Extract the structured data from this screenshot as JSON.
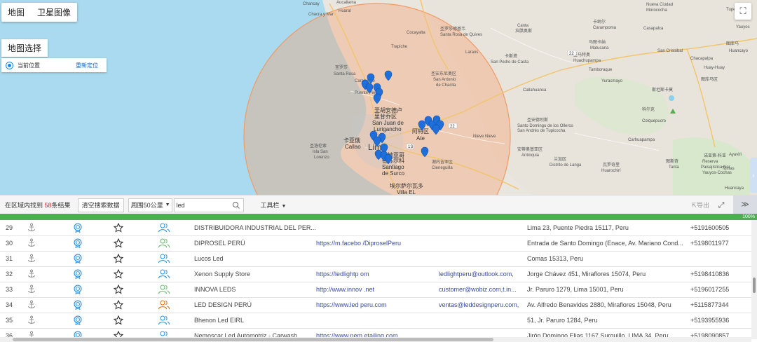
{
  "map": {
    "maptype_tabs": [
      "地图",
      "卫星图像"
    ],
    "map_select_label": "地图选择",
    "current_location_label": "当前位置",
    "relocate_label": "重新定位",
    "place_labels": [
      {
        "text": "Chancay"
      },
      {
        "text": "Chacra y Mar"
      },
      {
        "text": "Huaral"
      },
      {
        "text": "Aucallama"
      },
      {
        "text": "Cocayalta"
      },
      {
        "text": "Trapiche"
      },
      {
        "text": "圣罗莎"
      },
      {
        "text": "Santa Rosa"
      },
      {
        "text": "卡拉韦约"
      },
      {
        "text": "Carabayllo"
      },
      {
        "text": "Puente Piedra"
      },
      {
        "text": "圣胡安德卢"
      },
      {
        "text": "里甘乔区"
      },
      {
        "text": "San Juan de"
      },
      {
        "text": "Lurigancho"
      },
      {
        "text": "卡亚俄"
      },
      {
        "text": "Callao"
      },
      {
        "text": "Lima"
      },
      {
        "text": "阿特区"
      },
      {
        "text": "Ate"
      },
      {
        "text": "圣洛伦索"
      },
      {
        "text": "Isla San"
      },
      {
        "text": "Lorenzo"
      },
      {
        "text": "圣地亚哥"
      },
      {
        "text": "德苏尔科"
      },
      {
        "text": "Santiago"
      },
      {
        "text": "de Surco"
      },
      {
        "text": "谢内吉亚区"
      },
      {
        "text": "Cieneguilla"
      },
      {
        "text": "埃尔萨尔瓦多"
      },
      {
        "text": "Villa EL"
      },
      {
        "text": "圣罗莎德基韦"
      },
      {
        "text": "Santa Rosa de Quives"
      },
      {
        "text": "圣安东尼奥区"
      },
      {
        "text": "San Antonio"
      },
      {
        "text": "de Chaclla"
      },
      {
        "text": "Nieve Nieve"
      },
      {
        "text": "卡斯塔"
      },
      {
        "text": "Casta"
      },
      {
        "text": "圣佩德罗"
      },
      {
        "text": "San Pedro de Casta"
      },
      {
        "text": "卡亚乌"
      },
      {
        "text": "Callahuanca"
      },
      {
        "text": "马图卡纳"
      },
      {
        "text": "Matucana"
      },
      {
        "text": "Tamboraque"
      },
      {
        "text": "Yuracmayo"
      },
      {
        "text": "Canta"
      },
      {
        "text": "拉腊奥斯"
      },
      {
        "text": "Laraos"
      },
      {
        "text": "卡纳尔"
      },
      {
        "text": "Carampoma"
      },
      {
        "text": "圣马特奥"
      },
      {
        "text": "Huachupampa"
      },
      {
        "text": "Santo Domingo de los Olleros"
      },
      {
        "text": "圣安德烈斯"
      },
      {
        "text": "San Andrés de Tupicocha"
      },
      {
        "text": "安蒂奥基亚区"
      },
      {
        "text": "Antioquia"
      },
      {
        "text": "兰加区"
      },
      {
        "text": "Distrito de Langa"
      },
      {
        "text": "瓦罗奇里"
      },
      {
        "text": "Huarochirí"
      },
      {
        "text": "Carhuapampa"
      },
      {
        "text": "Tanta"
      },
      {
        "text": "图斯奇"
      },
      {
        "text": "Tomas"
      },
      {
        "text": "Nueva Ciudad"
      },
      {
        "text": "Morococha"
      },
      {
        "text": "Casapalca"
      },
      {
        "text": "圣克鲁斯"
      },
      {
        "text": "San Cristóbal"
      },
      {
        "text": "Huay-Huay"
      },
      {
        "text": "图库马"
      },
      {
        "text": "Huancayo"
      },
      {
        "text": "图库马"
      },
      {
        "text": "Chacapalpa"
      },
      {
        "text": "科尔克"
      },
      {
        "text": "Colquepucro"
      },
      {
        "text": "诺亚第-科亚"
      },
      {
        "text": "斯坦斯卡莫"
      },
      {
        "text": "Reserva Paisajística Nor Yauyos-Cochas"
      },
      {
        "text": "Huancaya"
      },
      {
        "text": "Tupe"
      },
      {
        "text": "Ayaviri"
      },
      {
        "text": "图库马区"
      },
      {
        "text": "Yauyos"
      }
    ],
    "pin_count": 29
  },
  "toolbar": {
    "found_prefix": "在区域内找到",
    "found_count": "58",
    "found_suffix": "条结果",
    "clear_button": "清空搜索数据",
    "radius_value": "周围50公里",
    "search_value": "led",
    "tools_label": "工具栏",
    "export_label": "导出"
  },
  "progress": {
    "label": "100%",
    "value_percent": 100
  },
  "rows": [
    {
      "num": "29",
      "name": "DISTRIBUIDORA INDUSTRIAL DEL PER...",
      "url": "",
      "email": "",
      "address": "Lima 23, Puente Piedra 15117, Peru",
      "phone": "+5191600505",
      "user_color": "#2196f3"
    },
    {
      "num": "30",
      "name": "DIPROSEL PERÚ",
      "url": "https://m.facebo      /DiproselPeru",
      "email": "",
      "address": "Entrada de Santo Domingo (Enace, Av. Mariano Cond...",
      "phone": "+5198011977",
      "user_color": "#66bb6a"
    },
    {
      "num": "31",
      "name": "Lucos Led",
      "url": "",
      "email": "",
      "address": "Comas 15313, Peru",
      "phone": "",
      "user_color": "#2196f3"
    },
    {
      "num": "32",
      "name": "Xenon Supply Store",
      "url": "https://ledlightp      om",
      "email": "ledlightperu@outlook.com,",
      "address": "Jorge Chávez 451, Miraflores 15074, Peru",
      "phone": "+5198410836",
      "user_color": "#2196f3"
    },
    {
      "num": "33",
      "name": "INNOVA LEDS",
      "url": "http://www.innov      .net",
      "email": "customer@wobiz.com,t.in...",
      "address": "Jr. Paruro 1279, Lima 15001, Peru",
      "phone": "+5196017255",
      "user_color": "#66bb6a"
    },
    {
      "num": "34",
      "name": "LED DESIGN PERÚ",
      "url": "https://www.led      peru.com",
      "email": "ventas@leddesignperu.com,",
      "address": "Av. Alfredo Benavides 2880, Miraflores 15048, Peru",
      "phone": "+5115877344",
      "user_color": "#ef6c00"
    },
    {
      "num": "35",
      "name": "Bhenon Led EIRL",
      "url": "",
      "email": "",
      "address": "51, Jr. Paruro 1284, Peru",
      "phone": "+5193955936",
      "user_color": "#2196f3"
    },
    {
      "num": "36",
      "name": "Nemoscar Led Automotriz - Carwash",
      "url": "https://www.nem      etailing.com",
      "email": "",
      "address": "Jirón Domingo Elias 1167 Surquillo, LIMA 34, Peru",
      "phone": "+5198090857",
      "user_color": "#2196f3"
    }
  ]
}
